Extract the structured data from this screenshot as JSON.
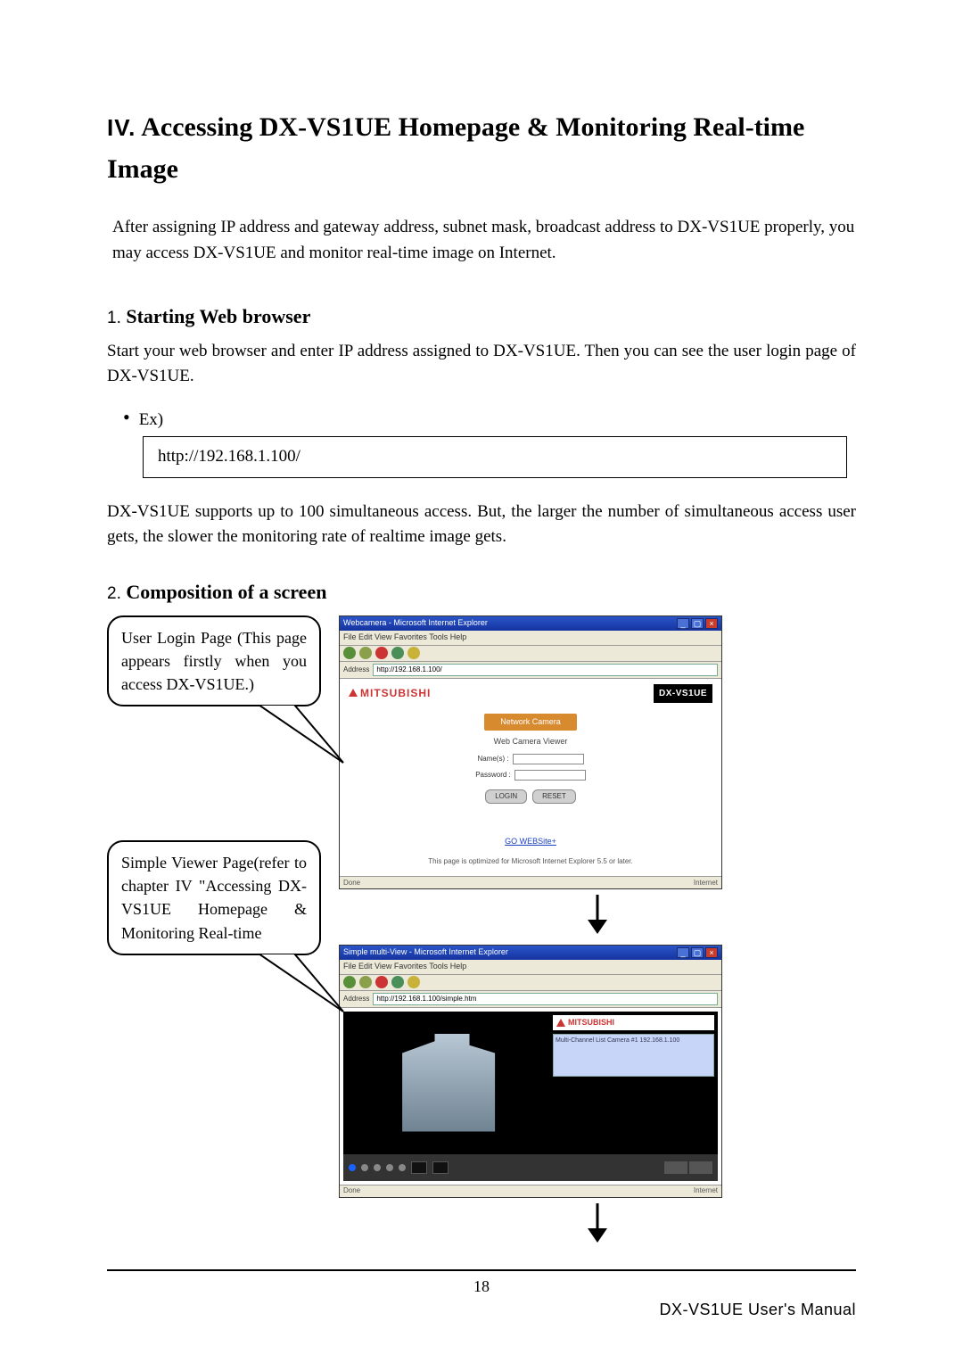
{
  "section": {
    "roman": "IV.",
    "title_rest": "Accessing DX-VS1UE Homepage & Monitoring Real-time Image"
  },
  "intro": "After assigning IP address and gateway address, subnet mask, broadcast address to DX-VS1UE properly, you may access DX-VS1UE and monitor real-time image on Internet.",
  "sub1": {
    "num": "1.",
    "title": "Starting Web browser",
    "body": "Start your web browser and enter IP address assigned to DX-VS1UE. Then you can see the user login page of DX-VS1UE.",
    "ex_label": "Ex)",
    "ex_value": "http://192.168.1.100/",
    "note": "DX-VS1UE supports up to 100 simultaneous access. But, the larger the number of simultaneous access user gets, the slower the monitoring rate of realtime image gets."
  },
  "sub2": {
    "num": "2.",
    "title": "Composition of a screen"
  },
  "callout1": "User Login Page (This page appears firstly when you access DX-VS1UE.)",
  "callout2": "Simple Viewer Page(refer to chapter IV \"Accessing DX-VS1UE Homepage & Monitoring Real-time",
  "shot1": {
    "title": "Webcamera - Microsoft Internet Explorer",
    "menu": "File  Edit  View  Favorites  Tools  Help",
    "addr_label": "Address",
    "addr_value": "http://192.168.1.100/",
    "brand_left": "MITSUBISHI",
    "brand_right": "DX-VS1UE",
    "login_btn": "Network Camera",
    "cam_title": "Web Camera Viewer",
    "name_label": "Name(s) :",
    "pass_label": "Password :",
    "btn_login": "LOGIN",
    "btn_reset": "RESET",
    "link": "GO WEBSite+",
    "footnote": "This page is optimized for Microsoft Internet Explorer 5.5 or later.",
    "status_left": "Done",
    "status_right": "Internet"
  },
  "shot2": {
    "title": "Simple multi-View - Microsoft Internet Explorer",
    "menu": "File  Edit  View  Favorites  Tools  Help",
    "addr_label": "Address",
    "addr_value": "http://192.168.1.100/simple.htm",
    "brand": "MITSUBISHI",
    "panel_text": "Multi-Channel List\nCamera #1\n192.168.1.100",
    "status_left": "Done",
    "status_right": "Internet"
  },
  "page_number": "18",
  "manual_label": "DX-VS1UE User's Manual"
}
